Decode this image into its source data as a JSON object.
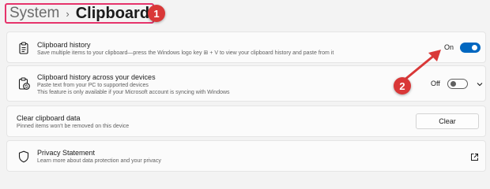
{
  "breadcrumb": {
    "parent": "System",
    "separator": "›",
    "current": "Clipboard"
  },
  "annotations": {
    "badge_1": "1",
    "badge_2": "2",
    "accent_color": "#d93838"
  },
  "settings": {
    "clipboard_history": {
      "icon": "clipboard-icon",
      "title": "Clipboard history",
      "description": "Save multiple items to your clipboard—press the Windows logo key ⊞ + V to view your clipboard history and paste from it",
      "state_label": "On",
      "enabled": true
    },
    "sync_devices": {
      "icon": "clipboard-sync-icon",
      "title": "Clipboard history across your devices",
      "description_1": "Paste text from your PC to supported devices",
      "description_2": "This feature is only available if your Microsoft account is syncing with Windows",
      "state_label": "Off",
      "enabled": false
    },
    "clear_data": {
      "title": "Clear clipboard data",
      "description": "Pinned items won't be removed on this device",
      "button_label": "Clear"
    },
    "privacy": {
      "icon": "shield-icon",
      "title": "Privacy Statement",
      "description": "Learn more about data protection and your privacy"
    }
  },
  "colors": {
    "toggle_on": "#0067c0",
    "highlight_border": "#e6336b"
  }
}
